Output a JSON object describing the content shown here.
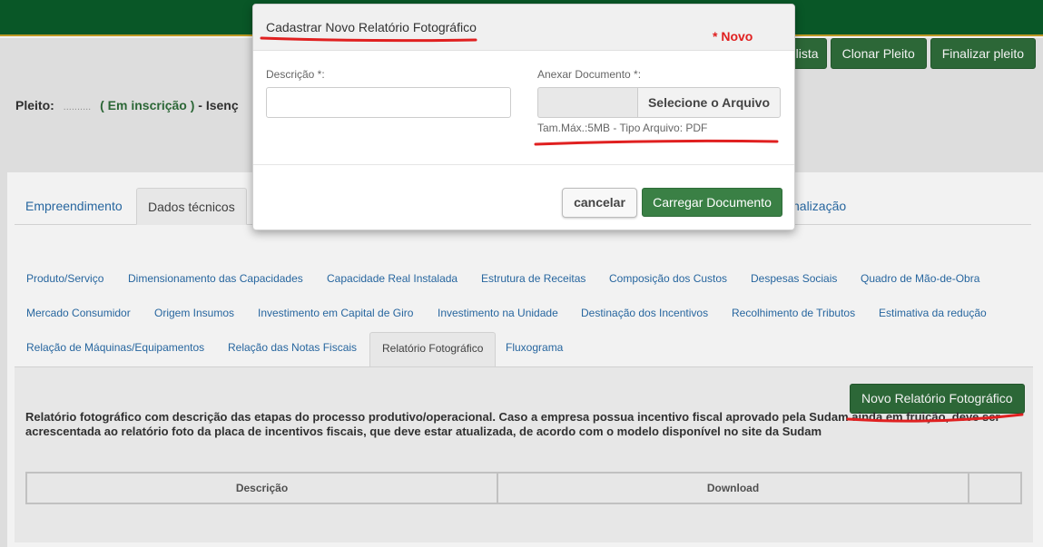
{
  "header": {
    "actions": [
      "a lista",
      "Clonar Pleito",
      "Finalizar pleito"
    ]
  },
  "pleito": {
    "label": "Pleito:",
    "masked": "..........",
    "status": "( Em inscrição )",
    "suffix": "- Isenç"
  },
  "main_tabs": [
    {
      "label": "Empreendimento",
      "active": false
    },
    {
      "label": "Dados técnicos",
      "active": true
    },
    {
      "label": "nalização",
      "active": false
    }
  ],
  "sub_tabs": {
    "row1": [
      "Produto/Serviço",
      "Dimensionamento das Capacidades",
      "Capacidade Real Instalada",
      "Estrutura de Receitas",
      "Composição dos Custos",
      "Despesas Sociais",
      "Quadro de Mão-de-Obra"
    ],
    "row2": [
      "Mercado Consumidor",
      "Origem Insumos",
      "Investimento em Capital de Giro",
      "Investimento na Unidade",
      "Destinação dos Incentivos",
      "Recolhimento de Tributos",
      "Estimativa da redução"
    ],
    "row3": [
      "Relação de Máquinas/Equipamentos",
      "Relação das Notas Fiscais",
      "Relatório Fotográfico",
      "Fluxograma"
    ],
    "active": "Relatório Fotográfico"
  },
  "content": {
    "new_button": "Novo Relatório Fotográfico",
    "description": "Relatório fotográfico com descrição das etapas do processo produtivo/operacional. Caso a empresa possua incentivo fiscal aprovado pela Sudam ainda em fruição, deve ser acrescentada ao relatório foto da placa de incentivos fiscais, que deve estar atualizada, de acordo com o modelo disponível no site da Sudam",
    "table_headers": [
      "Descrição",
      "Download",
      ""
    ]
  },
  "modal": {
    "title": "Cadastrar Novo Relatório Fotográfico",
    "annotation": "* Novo",
    "desc_label": "Descrição *:",
    "desc_value": "",
    "attach_label": "Anexar Documento *:",
    "file_button": "Selecione o Arquivo",
    "hint": "Tam.Máx.:5MB - Tipo Arquivo: PDF",
    "cancel": "cancelar",
    "upload": "Carregar Documento"
  },
  "colors": {
    "brand_green": "#0a5c2a",
    "button_green": "#2f6d3a",
    "link_blue": "#2a6ca8",
    "annotation_red": "#e02020"
  }
}
